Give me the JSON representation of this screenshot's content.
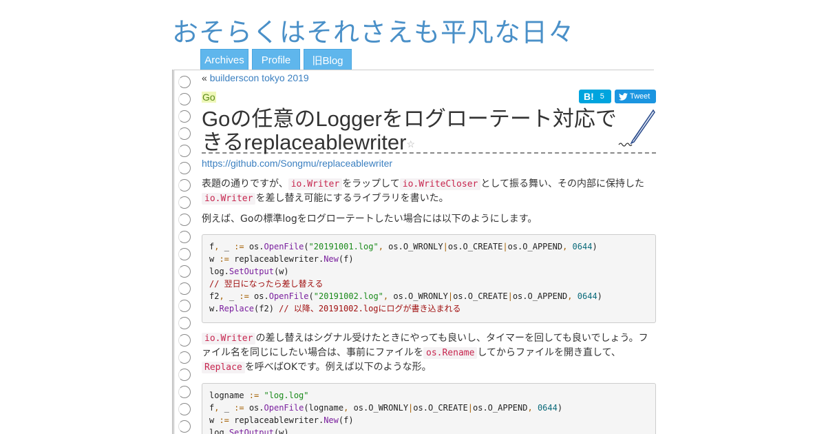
{
  "site": {
    "title": "おそらくはそれさえも平凡な日々"
  },
  "nav": {
    "archives": "Archives",
    "profile": "Profile",
    "old_blog": "旧Blog"
  },
  "prev": {
    "prefix": "«",
    "label": "builderscon tokyo 2019"
  },
  "post": {
    "category": "Go",
    "hatena_count": "5",
    "tweet_label": "Tweet",
    "title": "Goの任意のLoggerをログローテート対応できるreplaceablewriter",
    "link": "https://github.com/Songmu/replaceablewriter",
    "p1": {
      "t1": "表題の通りですが、",
      "c1": "io.Writer",
      "t2": "をラップして",
      "c2": "io.WriteCloser",
      "t3": "として振る舞い、その内部に保持した",
      "c3": "io.Writer",
      "t4": "を差し替え可能にするライブラリを書いた。"
    },
    "p2": "例えば、Goの標準logをログローテートしたい場合には以下のようにします。",
    "p3": {
      "c1": "io.Writer",
      "t1": "の差し替えはシグナル受けたときにやっても良いし、タイマーを回しても良いでしょう。ファイル名を同じにしたい場合は、事前にファイルを",
      "c2": "os.Rename",
      "t2": "してからファイルを開き直して、",
      "c3": "Replace",
      "t3": "を呼べばOKです。例えば以下のような形。"
    }
  },
  "code1": [
    "f, _ := os.OpenFile(\"20191001.log\", os.O_WRONLY|os.O_CREATE|os.O_APPEND, 0644)",
    "w := replaceablewriter.New(f)",
    "log.SetOutput(w)",
    "// 翌日になったら差し替える",
    "f2, _ := os.OpenFile(\"20191002.log\", os.O_WRONLY|os.O_CREATE|os.O_APPEND, 0644)",
    "w.Replace(f2) // 以降、20191002.logにログが書き込まれる"
  ],
  "code2": [
    "logname := \"log.log\"",
    "f, _ := os.OpenFile(logname, os.O_WRONLY|os.O_CREATE|os.O_APPEND, 0644)",
    "w := replaceablewriter.New(f)",
    "log.SetOutput(w)"
  ]
}
